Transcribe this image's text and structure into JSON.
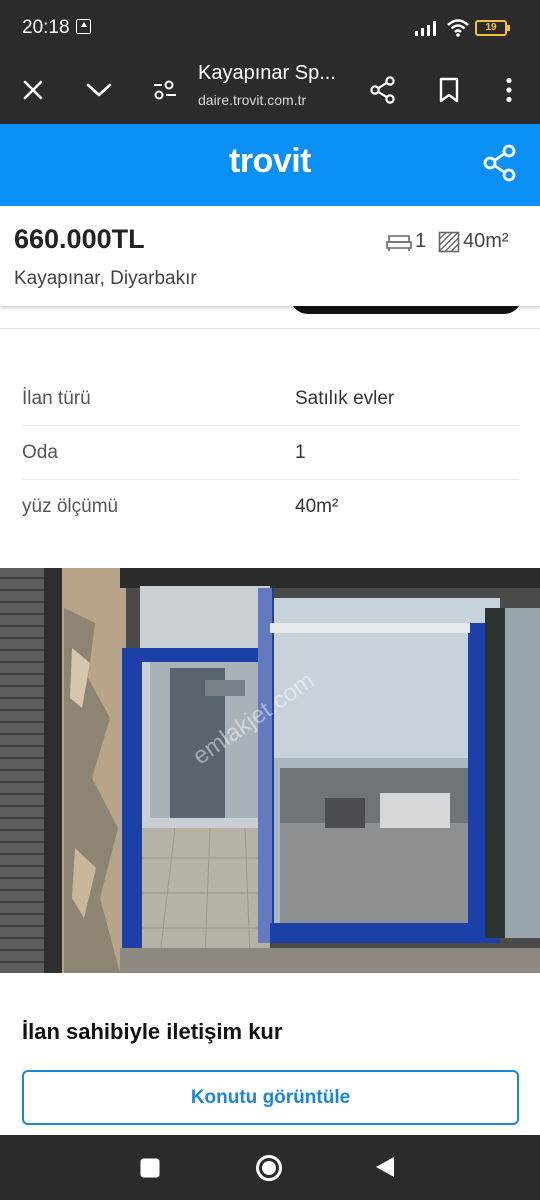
{
  "status": {
    "time": "20:18",
    "battery": "19"
  },
  "browser": {
    "title": "Kayapınar Sp...",
    "url": "daire.trovit.com.tr"
  },
  "site": {
    "logo": "trovit"
  },
  "listing": {
    "price": "660.000TL",
    "location": "Kayapınar, Diyarbakır",
    "rooms": "1",
    "area": "40m²"
  },
  "details": [
    {
      "key": "İlan türü",
      "value": "Satılık evler"
    },
    {
      "key": "Oda",
      "value": "1"
    },
    {
      "key": "yüz ölçümü",
      "value": "40m²"
    }
  ],
  "photo": {
    "watermark": "emlakjet.com"
  },
  "contact": {
    "title": "İlan sahibiyle iletişim kur",
    "button": "Konutu görüntüle"
  },
  "icons": [
    "close-icon",
    "chevron-down-icon",
    "page-settings-icon",
    "share-icon",
    "bookmark-icon",
    "more-vert-icon",
    "bed-icon",
    "area-icon",
    "nav-recents-icon",
    "nav-home-icon",
    "nav-back-icon"
  ],
  "colors": {
    "brand": "#0a8ff5",
    "button": "#1d86d8",
    "bars": "#2b2b2b"
  }
}
